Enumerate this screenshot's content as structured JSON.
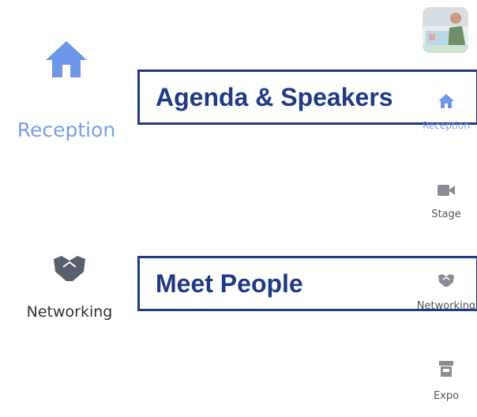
{
  "main_nav": {
    "reception_label": "Reception",
    "networking_label": "Networking"
  },
  "callouts": {
    "agenda": "Agenda & Speakers",
    "meet": "Meet People"
  },
  "sidebar": {
    "items": [
      {
        "label": "Reception",
        "icon": "home-icon",
        "active": true
      },
      {
        "label": "Stage",
        "icon": "video-camera-icon",
        "active": false
      },
      {
        "label": "Networking",
        "icon": "handshake-icon",
        "active": false
      },
      {
        "label": "Expo",
        "icon": "storefront-icon",
        "active": false
      }
    ]
  },
  "colors": {
    "active": "#7a9ee6",
    "inactive_icon": "#5a5f6e",
    "callout": "#1f3a86"
  }
}
